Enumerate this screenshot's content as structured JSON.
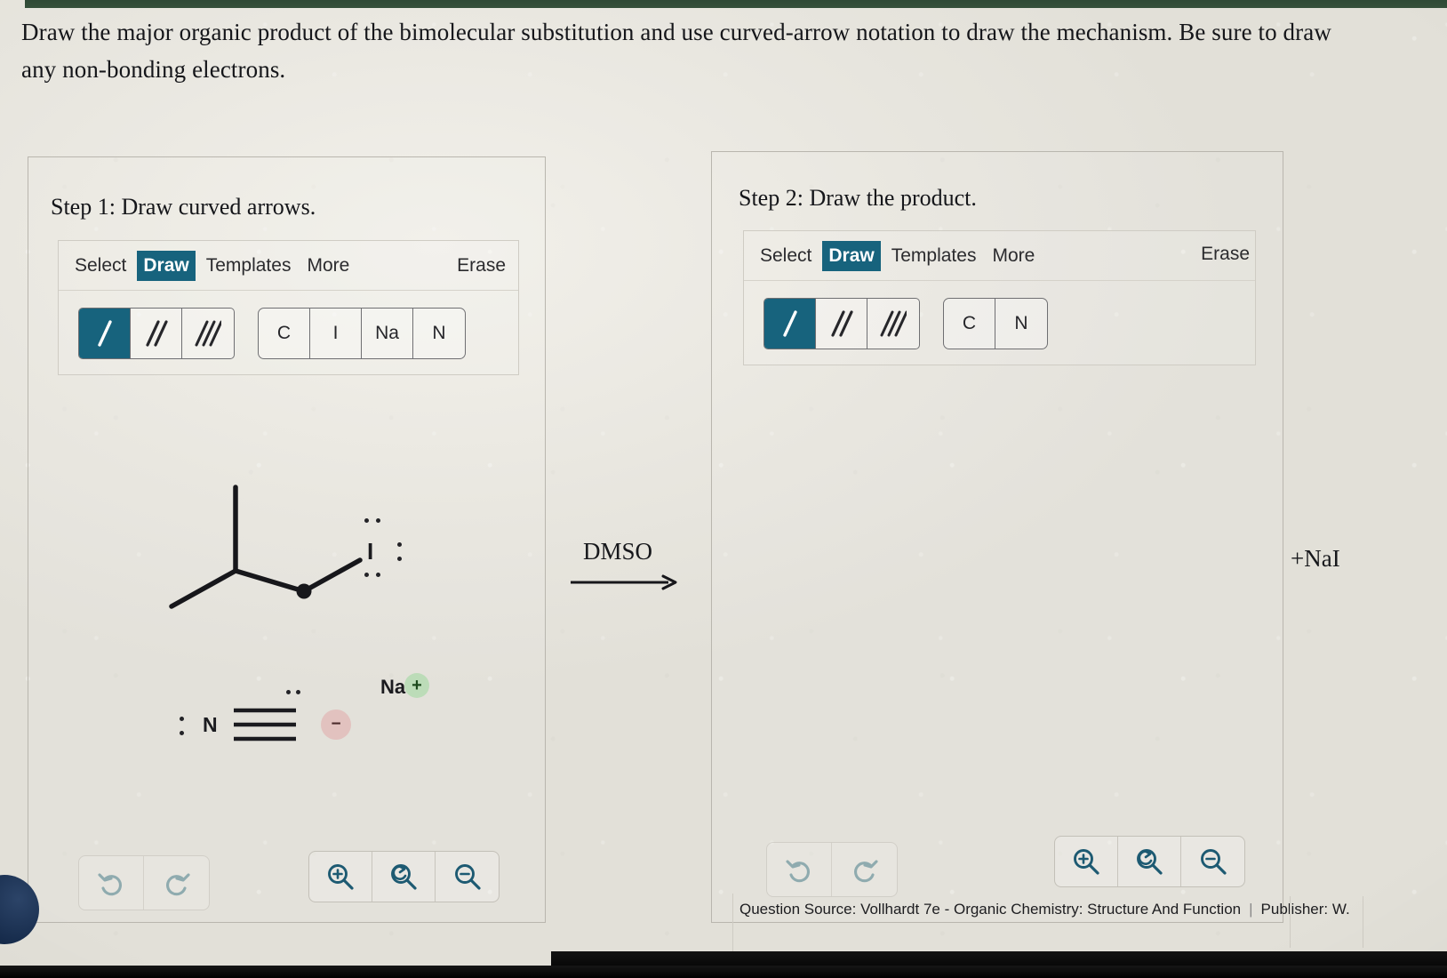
{
  "prompt": "Draw the major organic product of the bimolecular substitution and use curved-arrow notation to draw the mechanism. Be sure to draw any non-bonding electrons.",
  "steps": [
    {
      "title": "Step 1: Draw curved arrows.",
      "menu": [
        "Select",
        "Draw",
        "Templates",
        "More"
      ],
      "active_menu": "Draw",
      "erase_label": "Erase",
      "bond_tools": [
        {
          "name": "single-bond",
          "selected": true
        },
        {
          "name": "double-bond",
          "selected": false
        },
        {
          "name": "triple-bond",
          "selected": false
        }
      ],
      "atom_tools": [
        "C",
        "I",
        "Na",
        "N"
      ]
    },
    {
      "title": "Step 2: Draw the product.",
      "menu": [
        "Select",
        "Draw",
        "Templates",
        "More"
      ],
      "active_menu": "Draw",
      "erase_label": "Erase",
      "bond_tools": [
        {
          "name": "single-bond",
          "selected": true
        },
        {
          "name": "double-bond",
          "selected": false
        },
        {
          "name": "triple-bond",
          "selected": false
        }
      ],
      "atom_tools": [
        "C",
        "N"
      ]
    }
  ],
  "structures": {
    "substrate": {
      "description": "isobutyl iodide skeleton",
      "halogen_label": "I",
      "lone_pairs": 3
    },
    "nucleophile": {
      "atom_label": "N",
      "bond_order": 3,
      "charge": "−",
      "counterion": "Na",
      "counterion_charge": "+"
    }
  },
  "reaction": {
    "reagent": "DMSO",
    "byproduct": "+NaI"
  },
  "actions": {
    "undo": "undo-icon",
    "redo": "redo-icon",
    "zoom_in": "zoom-in-icon",
    "zoom_reset": "zoom-reset-icon",
    "zoom_out": "zoom-out-icon"
  },
  "footer": {
    "source": "Question Source: Vollhardt 7e - Organic Chemistry: Structure And Function",
    "divider": "|",
    "publisher": "Publisher: W."
  },
  "colors": {
    "accent_teal": "#17637d",
    "top_bar_green": "#2f4a36",
    "negative_badge": "#e2aaaa",
    "positive_badge": "#96d796"
  }
}
